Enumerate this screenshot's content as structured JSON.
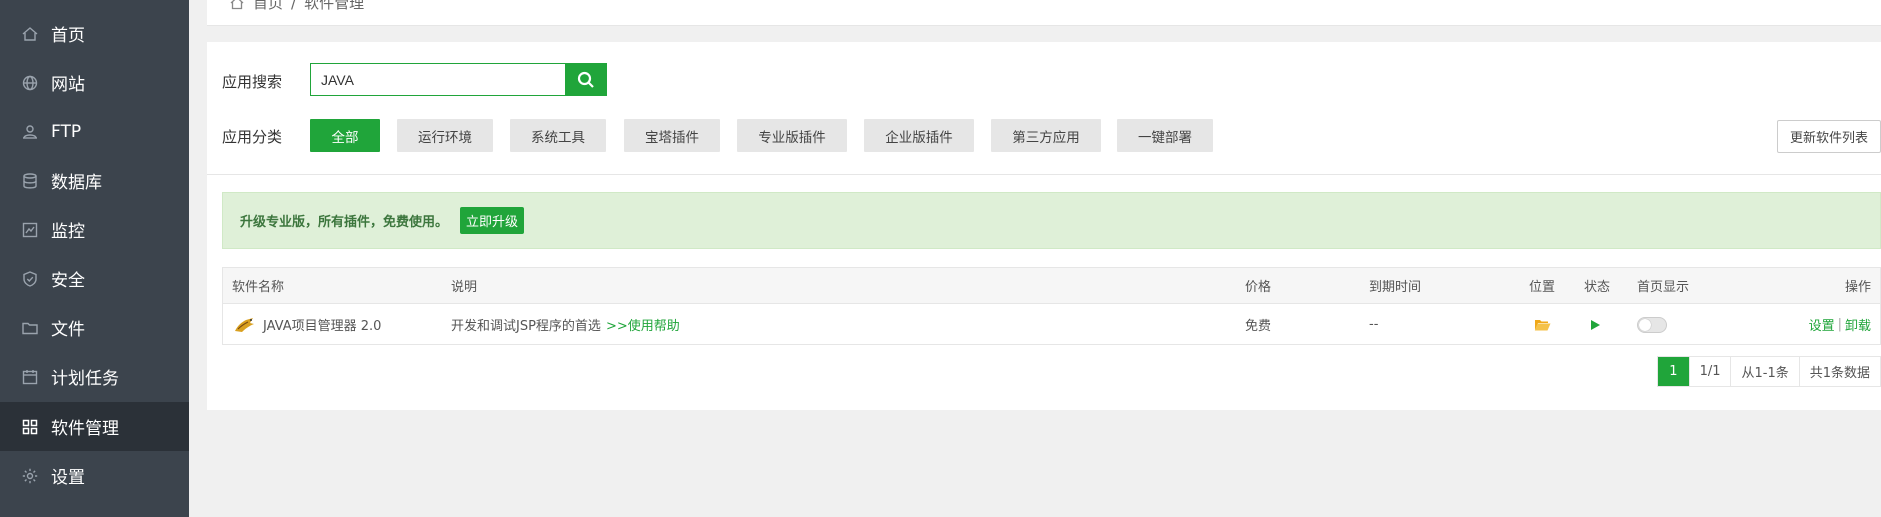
{
  "sidebar": {
    "items": [
      {
        "label": "首页",
        "icon": "home-icon"
      },
      {
        "label": "网站",
        "icon": "globe-icon"
      },
      {
        "label": "FTP",
        "icon": "ftp-icon"
      },
      {
        "label": "数据库",
        "icon": "database-icon"
      },
      {
        "label": "监控",
        "icon": "monitor-icon"
      },
      {
        "label": "安全",
        "icon": "shield-icon"
      },
      {
        "label": "文件",
        "icon": "folder-icon"
      },
      {
        "label": "计划任务",
        "icon": "calendar-icon"
      },
      {
        "label": "软件管理",
        "icon": "grid-icon",
        "active": true
      },
      {
        "label": "设置",
        "icon": "gear-icon"
      }
    ]
  },
  "breadcrumb": {
    "home": "首页",
    "separator": "/",
    "current": "软件管理"
  },
  "search": {
    "label": "应用搜索",
    "value": "JAVA",
    "placeholder": ""
  },
  "category": {
    "label": "应用分类",
    "items": [
      "全部",
      "运行环境",
      "系统工具",
      "宝塔插件",
      "专业版插件",
      "企业版插件",
      "第三方应用",
      "一键部署"
    ],
    "active_index": 0
  },
  "refresh_label": "更新软件列表",
  "notice": {
    "text": "升级专业版，所有插件，免费使用。",
    "button": "立即升级"
  },
  "table": {
    "headers": {
      "name": "软件名称",
      "desc": "说明",
      "price": "价格",
      "expire": "到期时间",
      "location": "位置",
      "status": "状态",
      "homepage": "首页显示",
      "actions": "操作"
    },
    "rows": [
      {
        "name": "JAVA项目管理器 2.0",
        "desc": "开发和调试JSP程序的首选",
        "help_link": ">>使用帮助",
        "price": "免费",
        "expire": "--",
        "status": "running",
        "homepage": false,
        "action_settings": "设置",
        "action_sep": "|",
        "action_uninstall": "卸载"
      }
    ]
  },
  "pagination": {
    "current": "1",
    "pages": "1/1",
    "range": "从1-1条",
    "total": "共1条数据"
  },
  "colors": {
    "accent": "#20a53a",
    "sidebar_bg": "#3c444d",
    "sidebar_active": "#2b3138",
    "notice_bg": "#dff0d8"
  }
}
